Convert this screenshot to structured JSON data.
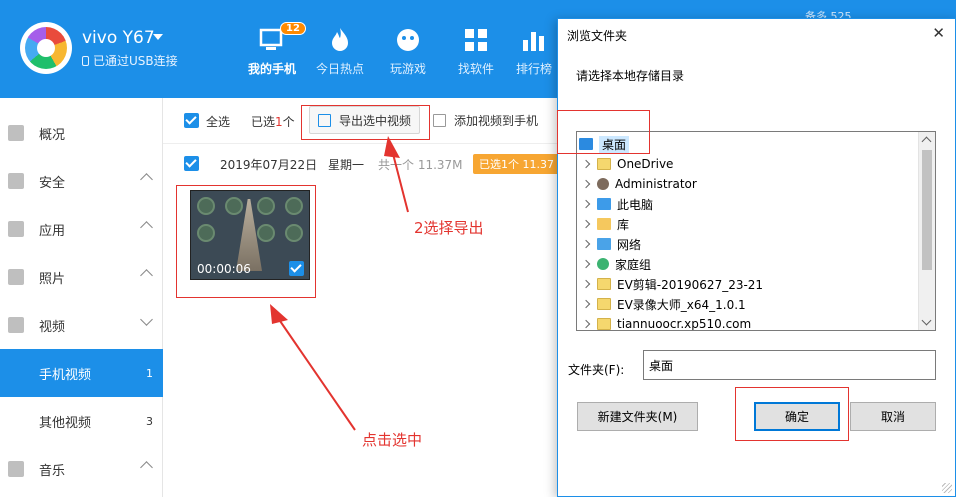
{
  "device": {
    "name": "vivo Y67",
    "status": "已通过USB连接"
  },
  "nav": [
    {
      "label": "我的手机",
      "badge": "12"
    },
    {
      "label": "今日热点"
    },
    {
      "label": "玩游戏"
    },
    {
      "label": "找软件"
    },
    {
      "label": "排行榜"
    }
  ],
  "top_right_text": "备多 525",
  "sidebar": {
    "items": [
      {
        "label": "概况"
      },
      {
        "label": "安全"
      },
      {
        "label": "应用"
      },
      {
        "label": "照片"
      },
      {
        "label": "视频"
      },
      {
        "label": "手机视频",
        "count": "1"
      },
      {
        "label": "其他视频",
        "count": "3"
      },
      {
        "label": "音乐"
      }
    ]
  },
  "toolbar": {
    "select_all": "全选",
    "selected_prefix": "已选",
    "selected_count": "1",
    "selected_suffix": "个",
    "export_label": "导出选中视频",
    "add_label": "添加视频到手机"
  },
  "date_row": {
    "date": "2019年07月22日",
    "weekday": "星期一",
    "total": "共一个 11.37M",
    "selected_badge": "已选1个 11.37"
  },
  "thumbnail": {
    "duration": "00:00:06"
  },
  "annotations": {
    "step2": "2选择导出",
    "step1": "点击选中"
  },
  "dialog": {
    "title": "浏览文件夹",
    "close": "✕",
    "prompt": "请选择本地存储目录",
    "tree": [
      {
        "label": "桌面",
        "icon": "desktop-icon"
      },
      {
        "label": "OneDrive",
        "icon": "folder-icon"
      },
      {
        "label": "Administrator",
        "icon": "user-icon"
      },
      {
        "label": "此电脑",
        "icon": "computer-icon"
      },
      {
        "label": "库",
        "icon": "library-icon"
      },
      {
        "label": "网络",
        "icon": "network-icon"
      },
      {
        "label": "家庭组",
        "icon": "homegroup-icon"
      },
      {
        "label": "EV剪辑-20190627_23-21",
        "icon": "folder-icon"
      },
      {
        "label": "EV录像大师_x64_1.0.1",
        "icon": "folder-icon"
      },
      {
        "label": "tiannuoocr.xp510.com",
        "icon": "folder-icon"
      }
    ],
    "folder_label": "文件夹(F):",
    "folder_value": "桌面",
    "new_folder": "新建文件夹(M)",
    "ok": "确定",
    "cancel": "取消"
  }
}
